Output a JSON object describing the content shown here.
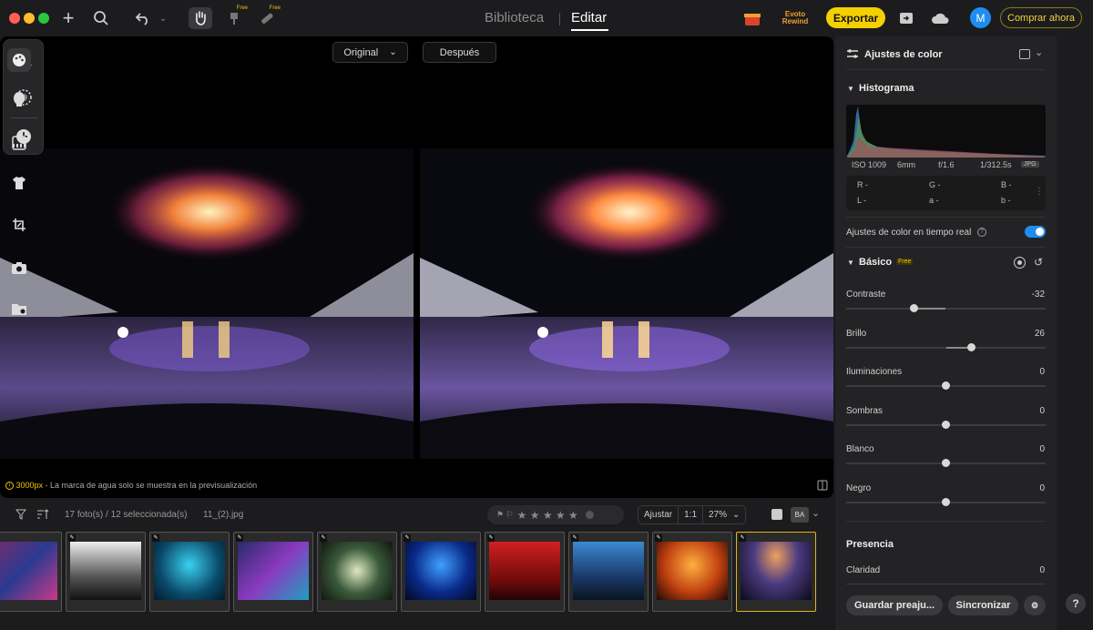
{
  "nav": {
    "tab_library": "Biblioteca",
    "tab_edit": "Editar",
    "free1": "Free",
    "free2": "Free",
    "export": "Exportar",
    "avatar": "M",
    "buy": "Comprar ahora",
    "promo": "Evoto Rewind"
  },
  "compare": {
    "before": "Original",
    "after": "Después"
  },
  "watermark": {
    "size": "3000px",
    "text": " - La marca de agua solo se muestra en la previsualización"
  },
  "filmstrip": {
    "count": "17 foto(s) / 12 seleccionada(s)",
    "filename": "11_(2).jpg",
    "fit": "Ajustar",
    "one": "1:1",
    "zoom": "27%",
    "ba": "BA",
    "stars": "★ ★ ★ ★ ★"
  },
  "panel": {
    "title": "Ajustes de color",
    "histogram": "Histograma",
    "exif": {
      "iso": "ISO 1009",
      "focal": "6mm",
      "aperture": "f/1.6",
      "shutter": "1/312.5s",
      "format": "JPG"
    },
    "rgb": {
      "r": "R -",
      "g": "G -",
      "b": "B -",
      "l": "L -",
      "a": "a -",
      "bb": "b -"
    },
    "realtime": "Ajustes de color en tiempo real",
    "basic": "Básico",
    "basic_free": "Free",
    "sliders": [
      {
        "label": "Contraste",
        "value": "-32",
        "pos": 0.34
      },
      {
        "label": "Brillo",
        "value": "26",
        "pos": 0.63
      },
      {
        "label": "Iluminaciones",
        "value": "0",
        "pos": 0.5
      },
      {
        "label": "Sombras",
        "value": "0",
        "pos": 0.5
      },
      {
        "label": "Blanco",
        "value": "0",
        "pos": 0.5
      },
      {
        "label": "Negro",
        "value": "0",
        "pos": 0.5
      }
    ],
    "presence": "Presencia",
    "clarity": {
      "label": "Claridad",
      "value": "0"
    },
    "save": "Guardar preaju...",
    "sync": "Sincronizar"
  }
}
